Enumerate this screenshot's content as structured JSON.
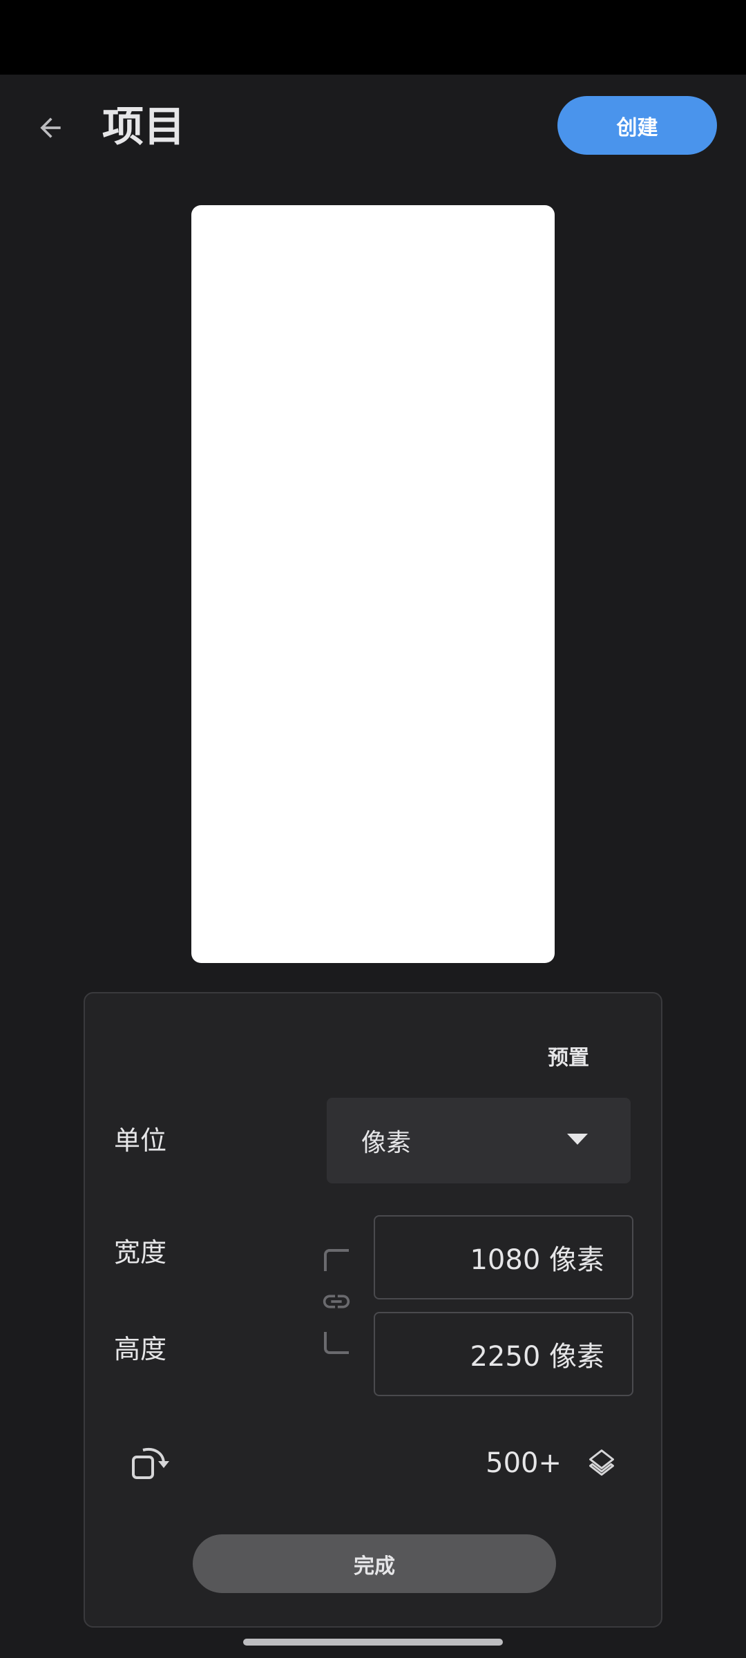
{
  "header": {
    "title": "项目",
    "create_label": "创建"
  },
  "panel": {
    "presets_label": "预置",
    "unit": {
      "label": "单位",
      "selected": "像素"
    },
    "width": {
      "label": "宽度",
      "value": "1080 像素"
    },
    "height": {
      "label": "高度",
      "value": "2250 像素"
    },
    "layers": {
      "count": "500+"
    },
    "done_label": "完成"
  },
  "colors": {
    "background": "#1b1b1d",
    "accent": "#4a94ec",
    "panel": "#232325",
    "canvas": "#ffffff"
  },
  "icons": {
    "back": "arrow-left-icon",
    "link": "link-icon",
    "rotate": "rotate-icon",
    "layers": "layers-icon",
    "dropdown": "caret-down-icon"
  }
}
